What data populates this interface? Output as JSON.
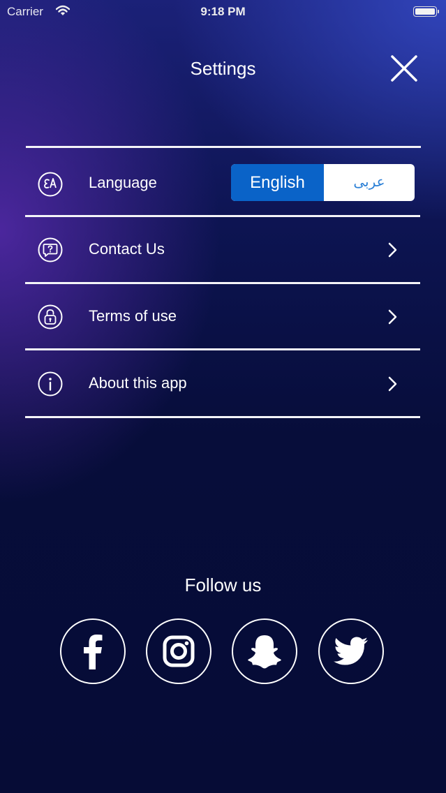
{
  "status_bar": {
    "carrier": "Carrier",
    "time": "9:18 PM"
  },
  "header": {
    "title": "Settings"
  },
  "settings": {
    "language": {
      "label": "Language",
      "options": [
        "English",
        "عربى"
      ],
      "selected": "English"
    },
    "items": [
      {
        "label": "Contact Us",
        "icon": "question-bubble-icon"
      },
      {
        "label": "Terms of use",
        "icon": "lock-icon"
      },
      {
        "label": "About this app",
        "icon": "info-icon"
      }
    ]
  },
  "social": {
    "title": "Follow us",
    "links": [
      "facebook-icon",
      "instagram-icon",
      "snapchat-icon",
      "twitter-icon"
    ]
  },
  "colors": {
    "accent": "#0a63c8",
    "background": "#070d3a",
    "text": "#ffffff"
  }
}
